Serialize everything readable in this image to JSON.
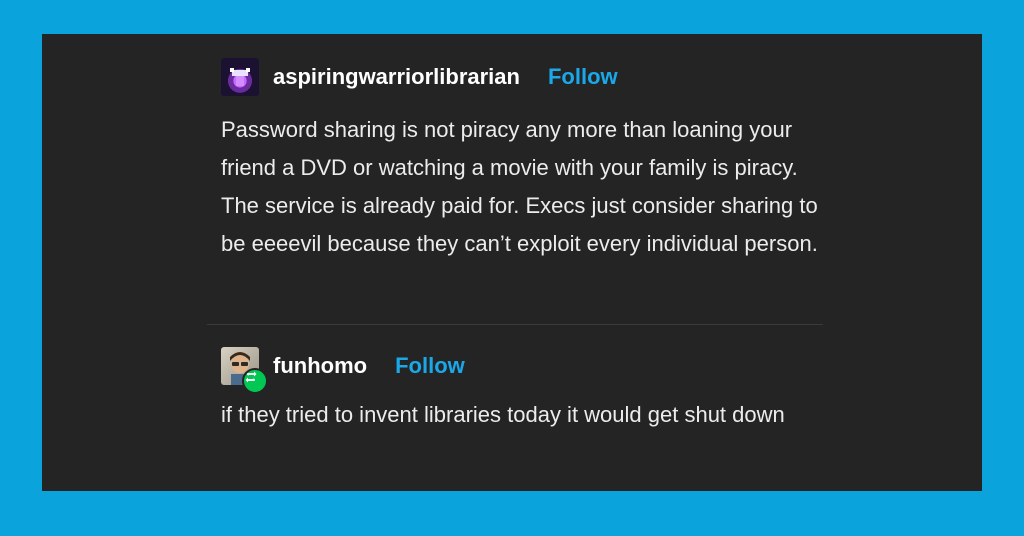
{
  "posts": [
    {
      "username": "aspiringwarriorlibrarian",
      "follow_label": "Follow",
      "text": "Password sharing is not piracy any more than loaning your friend a DVD or watching a movie with your family is piracy. The service is already paid for. Execs just consider sharing to be eeeevil because they can’t exploit every individual person."
    },
    {
      "username": "funhomo",
      "follow_label": "Follow",
      "text": "if they tried to invent libraries today it would get shut down",
      "badge": "reblog-icon"
    }
  ],
  "colors": {
    "background": "#0aa3dc",
    "card": "#242424",
    "follow": "#1ba8ea",
    "reblog_badge": "#00c853"
  }
}
